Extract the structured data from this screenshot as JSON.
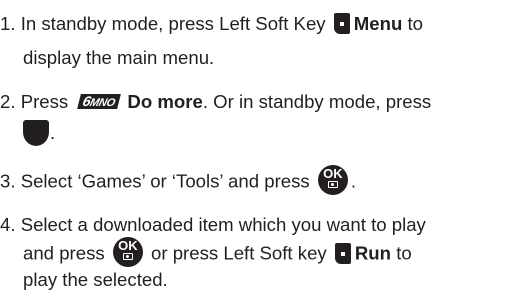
{
  "steps": [
    {
      "number": "1.",
      "line1_pre": "In standby mode, press Left Soft Key",
      "line1_bold": "Menu",
      "line1_post": "to",
      "line2": "display the main menu.",
      "icons": [
        "left-soft-key-icon"
      ]
    },
    {
      "number": "2.",
      "line1_pre": "Press",
      "key_label": "MNO",
      "key_digit": "6",
      "line1_bold": "Do more",
      "line1_post": ". Or in standby mode, press",
      "line2": ".",
      "icons": [
        "key-6-mno-icon",
        "navigation-down-key-icon"
      ]
    },
    {
      "number": "3.",
      "line1_pre": "Select ‘Games’ or ‘Tools’ and press",
      "line1_post": ".",
      "icons": [
        "ok-camera-key-icon"
      ]
    },
    {
      "number": "4.",
      "line1": "Select a downloaded item which you want to play",
      "line2_pre": "and press",
      "line2_mid": "or press Left Soft key",
      "line2_bold": "Run",
      "line2_post": "to",
      "line3": "play the selected.",
      "icons": [
        "ok-camera-key-icon",
        "left-soft-key-icon"
      ]
    }
  ],
  "ok_key_label": "OK"
}
